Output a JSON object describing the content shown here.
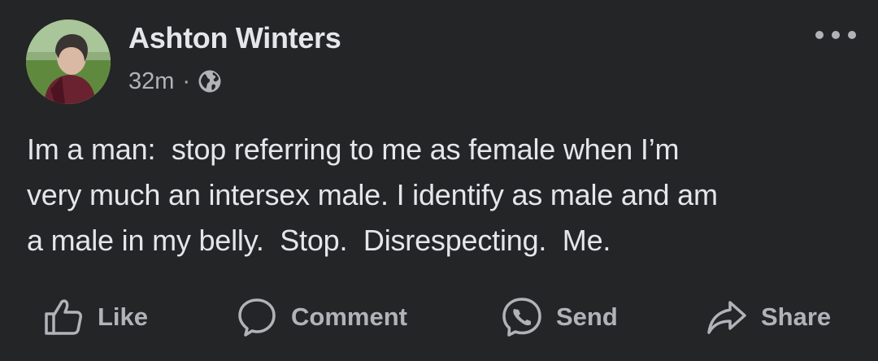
{
  "post": {
    "author_name": "Ashton Winters",
    "time": "32m",
    "separator": "·",
    "audience_icon": "globe-icon",
    "more_icon": "more-options-icon",
    "text": "Im a man:  stop referring to me as female when I’m\nvery much an intersex male. I identify as male and am\na male in my belly.  Stop.  Disrespecting.  Me."
  },
  "actions": {
    "like": {
      "label": "Like",
      "icon": "thumbs-up-icon"
    },
    "comment": {
      "label": "Comment",
      "icon": "comment-icon"
    },
    "send": {
      "label": "Send",
      "icon": "messenger-icon"
    },
    "share": {
      "label": "Share",
      "icon": "share-icon"
    }
  },
  "colors": {
    "background": "#242526",
    "primary_text": "#e4e6eb",
    "secondary_text": "#b0b3b8"
  }
}
